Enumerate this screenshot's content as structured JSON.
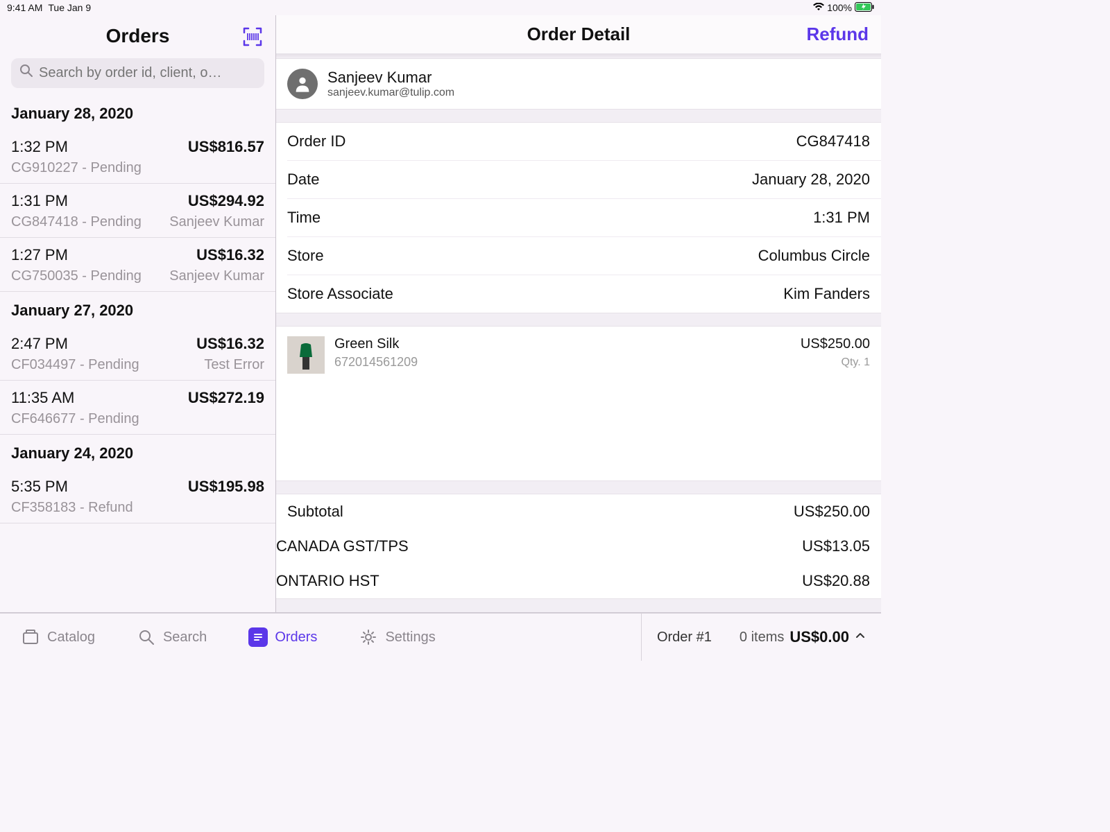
{
  "status": {
    "time": "9:41 AM",
    "date": "Tue Jan 9",
    "battery": "100%"
  },
  "sidebar": {
    "title": "Orders",
    "search_placeholder": "Search by order id, client, o…",
    "groups": [
      {
        "date": "January 28, 2020",
        "orders": [
          {
            "time": "1:32 PM",
            "amount": "US$816.57",
            "idline": "CG910227 - Pending",
            "client": ""
          },
          {
            "time": "1:31 PM",
            "amount": "US$294.92",
            "idline": "CG847418 - Pending",
            "client": "Sanjeev Kumar"
          },
          {
            "time": "1:27 PM",
            "amount": "US$16.32",
            "idline": "CG750035 - Pending",
            "client": "Sanjeev Kumar"
          }
        ]
      },
      {
        "date": "January 27, 2020",
        "orders": [
          {
            "time": "2:47 PM",
            "amount": "US$16.32",
            "idline": "CF034497 - Pending",
            "client": "Test Error"
          },
          {
            "time": "11:35 AM",
            "amount": "US$272.19",
            "idline": "CF646677 - Pending",
            "client": ""
          }
        ]
      },
      {
        "date": "January 24, 2020",
        "orders": [
          {
            "time": "5:35 PM",
            "amount": "US$195.98",
            "idline": "CF358183 - Refund",
            "client": ""
          }
        ]
      }
    ]
  },
  "detail": {
    "title": "Order Detail",
    "refund": "Refund",
    "customer": {
      "name": "Sanjeev Kumar",
      "email": "sanjeev.kumar@tulip.com"
    },
    "fields": [
      {
        "label": "Order ID",
        "value": "CG847418"
      },
      {
        "label": "Date",
        "value": "January 28, 2020"
      },
      {
        "label": "Time",
        "value": "1:31 PM"
      },
      {
        "label": "Store",
        "value": "Columbus Circle"
      },
      {
        "label": "Store Associate",
        "value": "Kim Fanders"
      }
    ],
    "items": [
      {
        "name": "Green Silk",
        "sku": "672014561209",
        "price": "US$250.00",
        "qty": "Qty. 1"
      }
    ],
    "totals": [
      {
        "label": "Subtotal",
        "value": "US$250.00"
      },
      {
        "label": "CANADA GST/TPS",
        "value": "US$13.05"
      },
      {
        "label": "ONTARIO HST",
        "value": "US$20.88"
      }
    ]
  },
  "tabbar": {
    "catalog": "Catalog",
    "search": "Search",
    "orders": "Orders",
    "settings": "Settings"
  },
  "cart": {
    "label": "Order #1",
    "items": "0 items",
    "total": "US$0.00"
  }
}
